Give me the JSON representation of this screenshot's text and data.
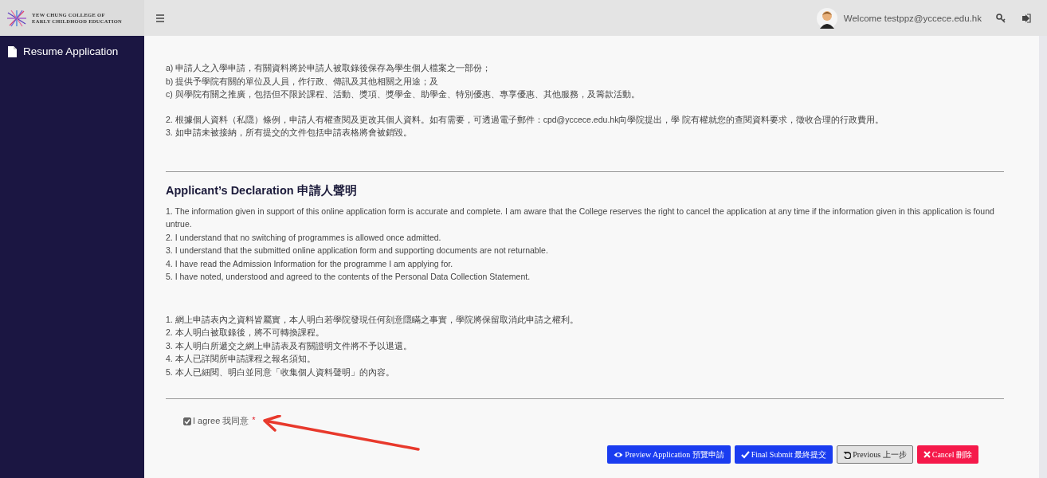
{
  "header": {
    "brand_line1": "YEW CHUNG COLLEGE OF",
    "brand_line2": "EARLY CHILDHOOD EDUCATION",
    "welcome": "Welcome testppz@yccece.edu.hk"
  },
  "sidebar": {
    "items": [
      {
        "label": "Resume Application"
      }
    ]
  },
  "privacy": {
    "purposes": [
      "a) 申請人之入學申請，有關資料將於申請人被取錄後保存為學生個人檔案之一部份；",
      "b) 提供予學院有關的單位及人員，作行政、傳訊及其他相關之用途；及",
      "c) 與學院有關之推廣，包括但不限於課程、活動、獎項、獎學金、助學金、特別優惠、專享優惠、其他服務，及籌款活動。"
    ],
    "notes": [
      "2. 根據個人資料（私隱）條例，申請人有權查閱及更改其個人資料。如有需要，可透過電子郵件：cpd@yccece.edu.hk向學院提出，學 院有權就您的查閱資料要求，徵收合理的行政費用。",
      "3. 如申請未被接納，所有提交的文件包括申請表格將會被銷毀。"
    ]
  },
  "declaration": {
    "title": "Applicant’s Declaration 申請人聲明",
    "english_items": [
      "1. The information given in support of this online application form is accurate and complete. I am aware that the College reserves the right to cancel the application at any time if the information given in this application is found untrue.",
      "2. I understand that no switching of programmes is allowed once admitted.",
      "3. I understand that the submitted online application form and supporting documents are not returnable.",
      "4. I have read the Admission Information for the programme I am applying for.",
      "5. I have noted, understood and agreed to the contents of the Personal Data Collection Statement."
    ],
    "chinese_items": [
      "1. 網上申請表內之資料皆屬實，本人明白若學院發現任何刻意隱瞞之事實，學院將保留取消此申請之權利。",
      "2. 本人明白被取錄後，將不可轉換課程。",
      "3. 本人明白所遞交之網上申請表及有關證明文件將不予以退還。",
      "4. 本人已詳閱所申請課程之報名須知。",
      "5. 本人已細閱、明白並同意「收集個人資料聲明」的內容。"
    ]
  },
  "agree": {
    "label": "I agree 我同意",
    "checked": true,
    "required_mark": "*"
  },
  "buttons": [
    {
      "label": "Preview Application 預覽申請",
      "kind": "preview"
    },
    {
      "label": "Final Submit 最終提交",
      "kind": "submit"
    },
    {
      "label": "Previous 上一步",
      "kind": "previous"
    },
    {
      "label": "Cancel 刪除",
      "kind": "cancel"
    }
  ]
}
